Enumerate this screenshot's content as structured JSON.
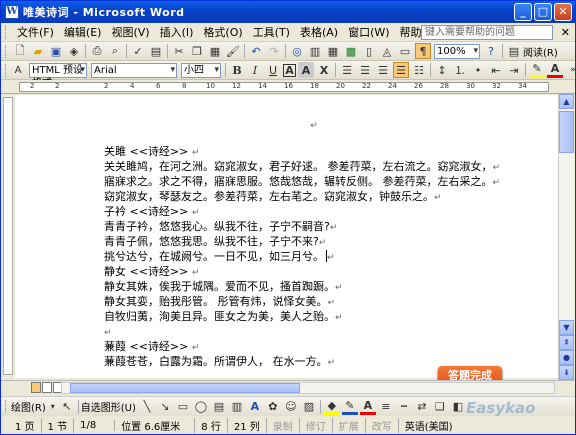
{
  "window": {
    "title": "唯美诗词 - Microsoft Word"
  },
  "menu": {
    "items": [
      "文件(F)",
      "编辑(E)",
      "视图(V)",
      "插入(I)",
      "格式(O)",
      "工具(T)",
      "表格(A)",
      "窗口(W)",
      "帮助(H)"
    ],
    "help_placeholder": "键入需要帮助的问题"
  },
  "toolbar": {
    "zoom": "100%",
    "read_label": "阅读(R)",
    "style": "HTML 预设格式",
    "font": "Arial",
    "size": "小四"
  },
  "document": {
    "lines": [
      "关雎 <<诗经>>",
      "关关雎鸠，在河之洲。窈窕淑女，君子好逑。 参差荇菜，左右流之。窈窕淑女，",
      "寤寐求之。求之不得，寤寐思服。悠哉悠哉，辗转反侧。 参差荇菜，左右采之。",
      "窈窕淑女，琴瑟友之。参差荇菜，左右芼之。窈窕淑女，钟鼓乐之。",
      "子衿 <<诗经>>",
      "青青子衿，悠悠我心。纵我不往，子宁不嗣音?",
      "青青子佩，悠悠我思。纵我不往，子宁不来?",
      "挑兮达兮，在城阙兮。一日不见，如三月兮。",
      "静女 <<诗经>>",
      "静女其姝，俟我于城隅。爱而不见，搔首踟蹰。",
      "静女其娈，贻我彤管。 彤管有炜，说怿女美。",
      "自牧归荑，洵美且异。匪女之为美，美人之贻。",
      "",
      "蒹葭 <<诗经>>",
      "蒹葭苍苍，白露为霜。所谓伊人， 在水一方。"
    ]
  },
  "status": {
    "page": "1 页",
    "section": "1 节",
    "of": "1/8",
    "position": "位置 6.6厘米",
    "line": "8 行",
    "col": "21 列",
    "rec": "录制",
    "trk": "修订",
    "ext": "扩展",
    "ovr": "改写",
    "lang": "英语(美国)"
  },
  "drawbar": {
    "draw": "绘图(R)",
    "autoshape": "自选图形(U)"
  },
  "overlay": {
    "done_button": "答题完成",
    "watermark": "Easykao"
  }
}
